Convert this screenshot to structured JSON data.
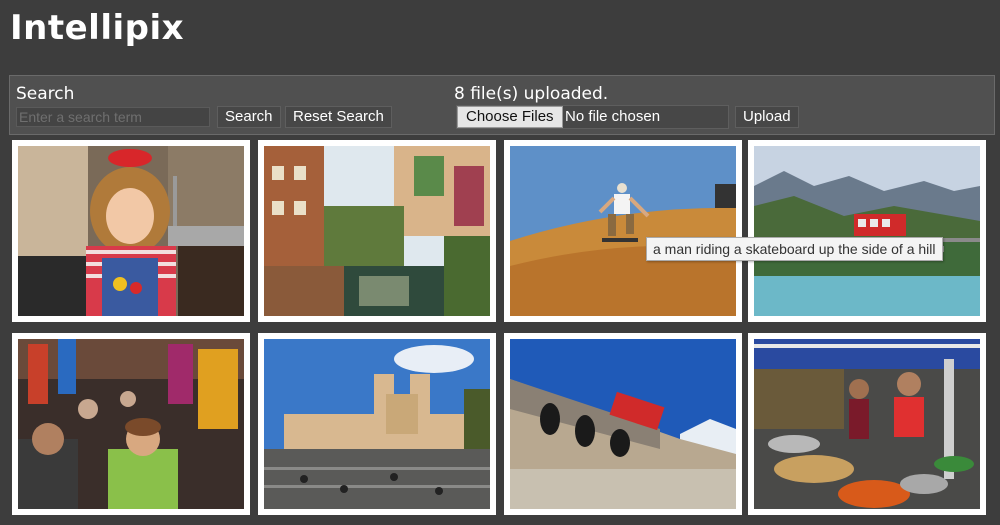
{
  "app": {
    "title": "Intellipix"
  },
  "search": {
    "label": "Search",
    "placeholder": "Enter a search term",
    "value": "",
    "search_button": "Search",
    "reset_button": "Reset Search"
  },
  "upload": {
    "status": "8 file(s) uploaded.",
    "choose_button": "Choose Files",
    "file_status": "No file chosen",
    "upload_button": "Upload"
  },
  "tooltip": {
    "text": "a man riding a skateboard up the side of a hill"
  },
  "colors": {
    "page_background": "#3d3d3d",
    "toolbar_background": "#505050",
    "thumbnail_frame": "#ffffff",
    "text": "#ffffff"
  },
  "gallery": {
    "images": [
      {
        "subject": "girl in red hat and overalls in kitchen"
      },
      {
        "subject": "canal with half-timbered houses"
      },
      {
        "subject": "man skateboarding up sand dune"
      },
      {
        "subject": "red cable car over alpine river"
      },
      {
        "subject": "crowded street market"
      },
      {
        "subject": "church with twin towers above steps"
      },
      {
        "subject": "red train on stone viaduct"
      },
      {
        "subject": "street food stall with woman cooking"
      }
    ]
  }
}
